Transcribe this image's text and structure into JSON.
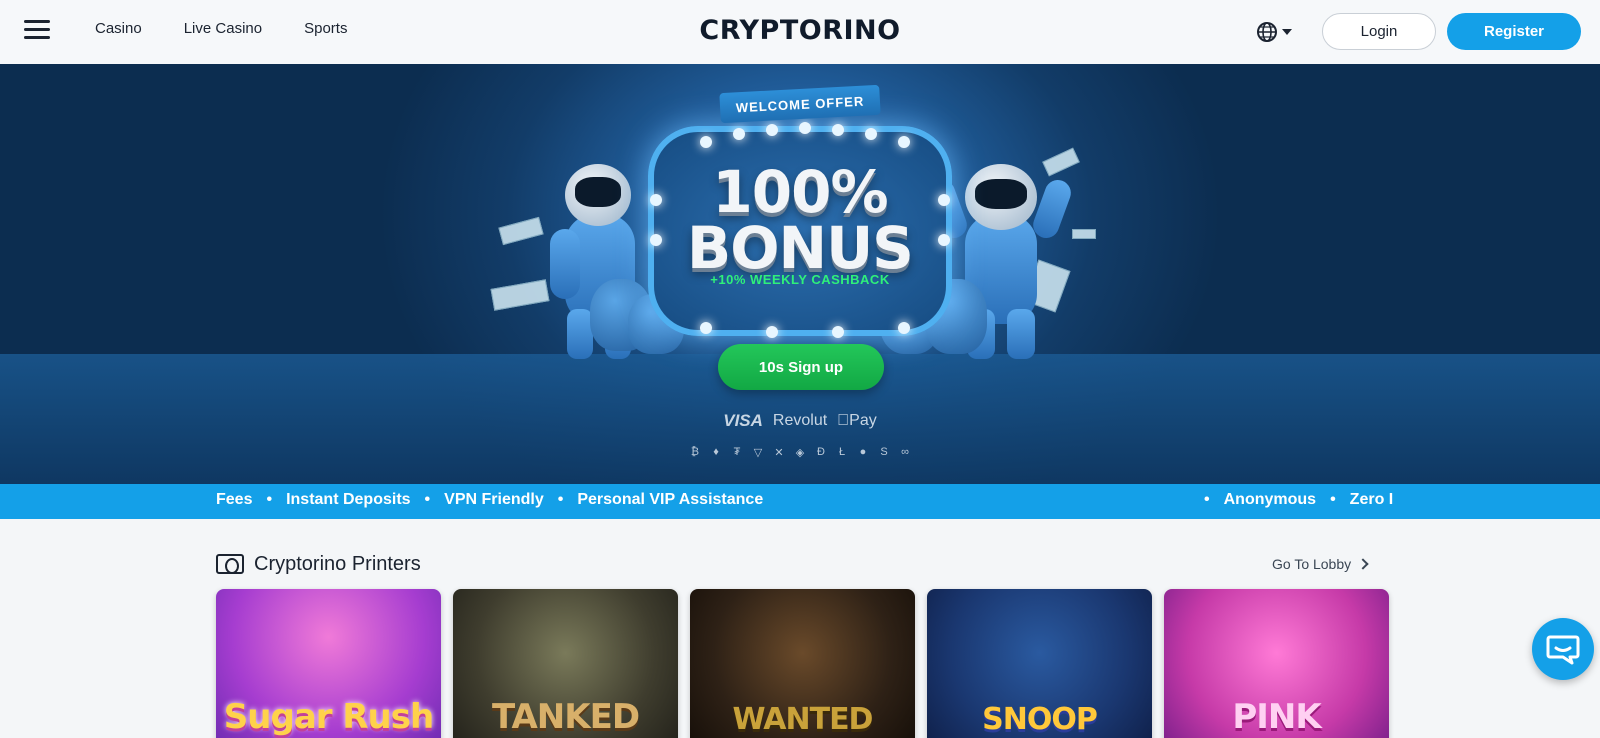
{
  "header": {
    "nav": [
      {
        "label": "Casino"
      },
      {
        "label": "Live Casino"
      },
      {
        "label": "Sports"
      }
    ],
    "logo": "CRYPTORINO",
    "language_icon": "globe-icon",
    "login_label": "Login",
    "register_label": "Register"
  },
  "hero": {
    "ribbon": "WELCOME OFFER",
    "bonus_line1": "100%",
    "bonus_line2": "BONUS",
    "cashback": "+10% WEEKLY CASHBACK",
    "signup_label": "10s Sign up",
    "payments": {
      "visa": "VISA",
      "revolut": "Revolut",
      "apple_pay": "Pay"
    },
    "crypto_icons": [
      "₿",
      "♦",
      "₮",
      "▽",
      "✕",
      "◈",
      "Đ",
      "Ł",
      "●",
      "S",
      "∞"
    ]
  },
  "ticker": {
    "left_items": [
      "Fees",
      "Instant Deposits",
      "VPN Friendly",
      "Personal VIP Assistance"
    ],
    "right_items": [
      "Anonymous",
      "Zero I"
    ]
  },
  "section": {
    "title": "Cryptorino Printers",
    "goto_label": "Go To Lobby",
    "games": [
      {
        "title": "Sugar Rush"
      },
      {
        "title": "TANKED"
      },
      {
        "title": "WANTED"
      },
      {
        "title": "SNOOP"
      },
      {
        "title": "PINK"
      }
    ]
  },
  "colors": {
    "accent": "#14a0e8",
    "signup": "#1cb650",
    "cashback": "#2ff07a",
    "header_bg": "#f6f8fa"
  }
}
